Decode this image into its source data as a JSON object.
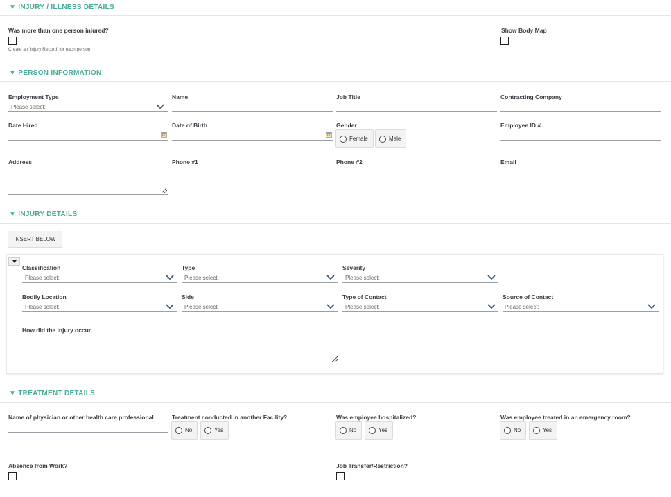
{
  "sections": {
    "injury_illness": {
      "title": "▼ INJURY / ILLNESS DETAILS"
    },
    "person": {
      "title": "▼ PERSON INFORMATION"
    },
    "injury_details": {
      "title": "▼ INJURY DETAILS"
    },
    "treatment": {
      "title": "▼ TREATMENT DETAILS"
    }
  },
  "injury_illness": {
    "multiple_injured_label": "Was more than one person injured?",
    "multiple_injured_hint": "Create an 'Injury Record' for each person",
    "show_body_map_label": "Show Body Map"
  },
  "person": {
    "employment_type_label": "Employment Type",
    "employment_type_placeholder": "Please select:",
    "name_label": "Name",
    "job_title_label": "Job Title",
    "contracting_company_label": "Contracting Company",
    "date_hired_label": "Date Hired",
    "dob_label": "Date of Birth",
    "gender_label": "Gender",
    "gender_female": "Female",
    "gender_male": "Male",
    "employee_id_label": "Employee ID #",
    "address_label": "Address",
    "phone1_label": "Phone #1",
    "phone2_label": "Phone #2",
    "email_label": "Email"
  },
  "injury_details": {
    "insert_below_label": "INSERT BELOW",
    "classification_label": "Classification",
    "type_label": "Type",
    "severity_label": "Severity",
    "bodily_location_label": "Bodily Location",
    "side_label": "Side",
    "type_of_contact_label": "Type of Contact",
    "source_of_contact_label": "Source of Contact",
    "placeholder": "Please select:",
    "how_occur_label": "How did the injury occur"
  },
  "treatment": {
    "physician_label": "Name of physician or other health care professional",
    "other_facility_label": "Treatment conducted in another Facility?",
    "hospitalized_label": "Was employee hospitalized?",
    "emergency_label": "Was employee treated in an emergency room?",
    "no": "No",
    "yes": "Yes",
    "absence_label": "Absence from Work?",
    "transfer_label": "Job Transfer/Restriction?"
  },
  "colors": {
    "accent": "#4aab93",
    "chevron": "#3b5a7a"
  }
}
